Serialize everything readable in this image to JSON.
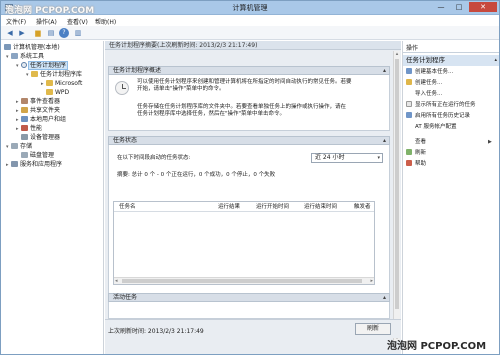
{
  "window": {
    "title": "计算机管理",
    "controls": {
      "minimize": "—",
      "maximize": "□",
      "close": "✕"
    }
  },
  "menu": [
    "文件(F)",
    "操作(A)",
    "查看(V)",
    "帮助(H)"
  ],
  "toolbar_icons": [
    "back-icon",
    "forward-icon",
    "folder-icon",
    "list-icon",
    "help-icon",
    "panel-icon"
  ],
  "tree": {
    "root": "计算机管理(本地)",
    "system_tools": "系统工具",
    "task_scheduler": "任务计划程序",
    "task_library": "任务计划程序库",
    "microsoft": "Microsoft",
    "wpd": "WPD",
    "event_viewer": "事件查看器",
    "shared_folders": "共享文件夹",
    "local_users": "本地用户和组",
    "performance": "性能",
    "device_manager": "设备管理器",
    "storage": "存储",
    "disk_management": "磁盘管理",
    "services": "服务和应用程序"
  },
  "center": {
    "header": "任务计划程序摘要(上次刷新时间: 2013/2/3 21:17:49)",
    "overview": {
      "title": "任务计划程序概述",
      "line1": "可以使用任务计划程序来创建和管理计算机将在所指定的时间自动执行的常见任务。若要",
      "line2": "开始，请单击\"操作\"菜单中的命令。",
      "line3": "任务存储在任务计划程序库的文件夹中。若要查看单独任务上的操作或执行操作，请在",
      "line4": "任务计划程序库中选择任务，然后在\"操作\"菜单中单击命令。"
    },
    "status": {
      "title": "任务状态",
      "period_label": "在以下时间段启动的任务状态:",
      "period_value": "近 24 小时",
      "summary": "摘要: 总计 0 个 - 0 个正在运行，0 个成功，0 个停止，0 个失败",
      "columns": [
        "任务名",
        "运行结果",
        "运行开始时间",
        "运行结束时间",
        "触发者"
      ]
    },
    "active": {
      "title": "活动任务"
    },
    "footer": {
      "last_refresh": "上次刷新时间: 2013/2/3 21:17:49",
      "refresh_label": "刷新"
    }
  },
  "actions": {
    "title": "操作",
    "group": "任务计划程序",
    "items": [
      {
        "label": "创建基本任务...",
        "icon": "b"
      },
      {
        "label": "创建任务...",
        "icon": "y"
      },
      {
        "label": "导入任务...",
        "icon": "n"
      },
      {
        "label": "显示所有正在运行的任务",
        "icon": "w"
      },
      {
        "label": "启用所有任务历史记录",
        "icon": "b"
      },
      {
        "label": "AT 服务帐户配置",
        "icon": "n"
      },
      {
        "label": "查看",
        "icon": "n"
      },
      {
        "label": "刷新",
        "icon": "g"
      },
      {
        "label": "帮助",
        "icon": "r"
      }
    ]
  },
  "watermarks": {
    "top": "泡泡网 PCPOP.COM",
    "bottom": "泡泡网 PCPOP.COM"
  }
}
